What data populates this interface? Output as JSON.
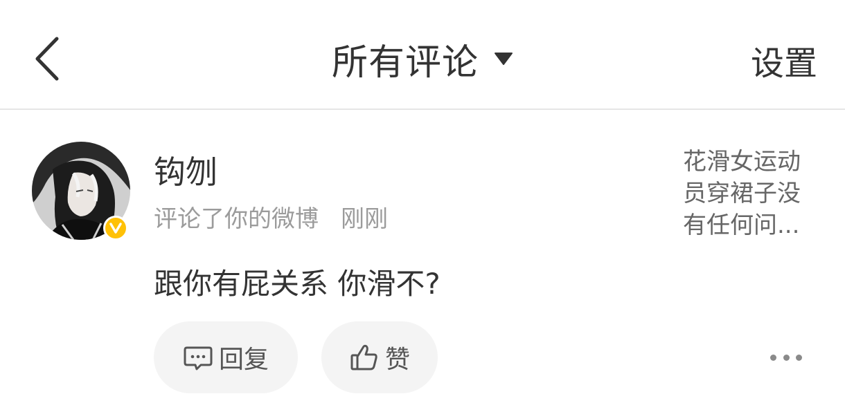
{
  "header": {
    "title": "所有评论",
    "settings_label": "设置"
  },
  "notification": {
    "username": "钩刎",
    "action_text": "评论了你的微博",
    "time": "刚刚",
    "comment": "跟你有屁关系 你滑不?",
    "preview_lines": [
      "花滑女运动",
      "员穿裙子没",
      "有任何问..."
    ],
    "verified_badge": "V"
  },
  "actions": {
    "reply_label": "回复",
    "like_label": "赞"
  },
  "colors": {
    "badge": "#ffc107",
    "text_primary": "#333333",
    "text_secondary": "#9b9b9b",
    "button_bg": "#f4f4f4"
  },
  "icons": {
    "back": "chevron-left-icon",
    "dropdown": "caret-down-icon",
    "reply": "comment-bubble-icon",
    "like": "thumbs-up-icon",
    "more": "more-dots-icon"
  }
}
